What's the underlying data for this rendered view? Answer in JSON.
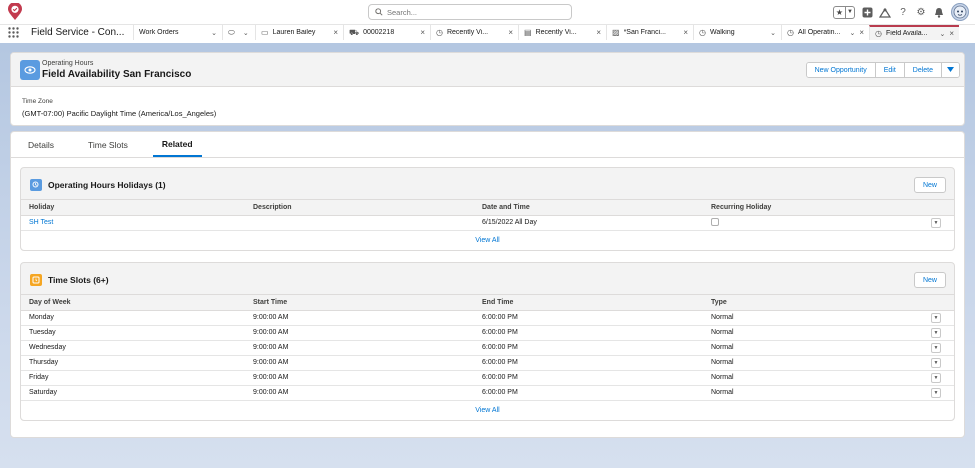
{
  "global_header": {
    "search_placeholder": "Search..."
  },
  "nav": {
    "app_name": "Field Service - Con...",
    "tabs": [
      {
        "label": "Work Orders",
        "icon": "",
        "chevron": true,
        "close": false
      },
      {
        "label": "",
        "icon": "tag-icon",
        "chevron": true,
        "close": false
      },
      {
        "label": "Lauren Bailey",
        "icon": "contact-icon",
        "chevron": false,
        "close": true
      },
      {
        "label": "00002218",
        "icon": "truck-icon",
        "chevron": false,
        "close": true
      },
      {
        "label": "Recently Vi...",
        "icon": "clock-icon",
        "chevron": false,
        "close": true
      },
      {
        "label": "Recently Vi...",
        "icon": "file-icon",
        "chevron": false,
        "close": true
      },
      {
        "label": "*San Franci...",
        "icon": "map-icon",
        "chevron": false,
        "close": true
      },
      {
        "label": "Walking",
        "icon": "clock-icon",
        "chevron": true,
        "close": false
      },
      {
        "label": "All Operatin...",
        "icon": "clock-icon",
        "chevron": true,
        "close": true
      },
      {
        "label": "Field Availa...",
        "icon": "clock-icon",
        "chevron": true,
        "close": true
      }
    ]
  },
  "record": {
    "object_type": "Operating Hours",
    "title": "Field Availability San Francisco",
    "buttons": {
      "new_opportunity": "New Opportunity",
      "edit": "Edit",
      "delete": "Delete"
    },
    "timezone_label": "Time Zone",
    "timezone_value": "(GMT-07:00) Pacific Daylight Time (America/Los_Angeles)"
  },
  "tabs": {
    "details": "Details",
    "time_slots": "Time Slots",
    "related": "Related"
  },
  "holidays": {
    "title": "Operating Hours Holidays (1)",
    "new_label": "New",
    "columns": [
      "Holiday",
      "Description",
      "Date and Time",
      "Recurring Holiday"
    ],
    "rows": [
      {
        "holiday": "SH Test",
        "description": "",
        "date_time": "6/15/2022 All Day"
      }
    ],
    "view_all": "View All"
  },
  "time_slots": {
    "title": "Time Slots (6+)",
    "new_label": "New",
    "columns": [
      "Day of Week",
      "Start Time",
      "End Time",
      "Type"
    ],
    "rows": [
      {
        "day": "Monday",
        "start": "9:00:00 AM",
        "end": "6:00:00 PM",
        "type": "Normal"
      },
      {
        "day": "Tuesday",
        "start": "9:00:00 AM",
        "end": "6:00:00 PM",
        "type": "Normal"
      },
      {
        "day": "Wednesday",
        "start": "9:00:00 AM",
        "end": "6:00:00 PM",
        "type": "Normal"
      },
      {
        "day": "Thursday",
        "start": "9:00:00 AM",
        "end": "6:00:00 PM",
        "type": "Normal"
      },
      {
        "day": "Friday",
        "start": "9:00:00 AM",
        "end": "6:00:00 PM",
        "type": "Normal"
      },
      {
        "day": "Saturday",
        "start": "9:00:00 AM",
        "end": "6:00:00 PM",
        "type": "Normal"
      }
    ],
    "view_all": "View All"
  },
  "colors": {
    "brand_blue": "#0176d3",
    "active_tab_accent": "#b83b4e",
    "holiday_icon": "#5a9be0",
    "timeslot_icon": "#f5a623"
  }
}
